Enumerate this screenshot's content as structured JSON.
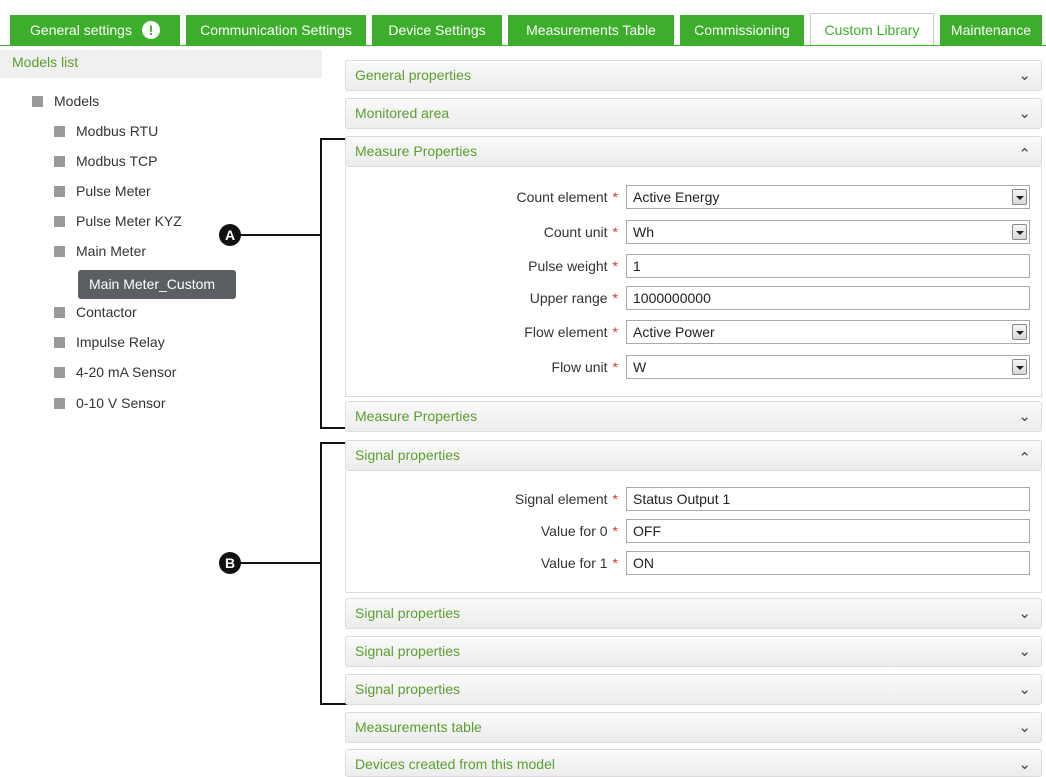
{
  "tabs": [
    {
      "label": "General settings",
      "warning": "!"
    },
    {
      "label": "Communication Settings"
    },
    {
      "label": "Device Settings"
    },
    {
      "label": "Measurements Table"
    },
    {
      "label": "Commissioning"
    },
    {
      "label": "Custom Library",
      "active": true
    },
    {
      "label": "Maintenance"
    }
  ],
  "models_list": {
    "header": "Models list",
    "root": "Models",
    "items": [
      "Modbus RTU",
      "Modbus TCP",
      "Pulse Meter",
      "Pulse Meter KYZ",
      "Main Meter"
    ],
    "selected_child": "Main Meter_Custom",
    "items_after": [
      "Contactor",
      "Impulse Relay",
      "4-20 mA Sensor",
      "0-10 V Sensor"
    ]
  },
  "callouts": {
    "a": "A",
    "b": "B"
  },
  "panels": {
    "general_properties": "General properties",
    "monitored_area": "Monitored area",
    "measure_properties_open": "Measure Properties",
    "measure_properties_closed": "Measure Properties",
    "signal_properties_open": "Signal properties",
    "signal_properties_closed_1": "Signal properties",
    "signal_properties_closed_2": "Signal properties",
    "signal_properties_closed_3": "Signal properties",
    "measurements_table": "Measurements table",
    "devices_created": "Devices created from this model"
  },
  "required_marker": "*",
  "measure_fields": [
    {
      "label": "Count element",
      "value": "Active Energy",
      "type": "select"
    },
    {
      "label": "Count unit",
      "value": "Wh",
      "type": "select"
    },
    {
      "label": "Pulse weight",
      "value": "1",
      "type": "text"
    },
    {
      "label": "Upper range",
      "value": "1000000000",
      "type": "text"
    },
    {
      "label": "Flow element",
      "value": "Active Power",
      "type": "select"
    },
    {
      "label": "Flow unit",
      "value": "W",
      "type": "select"
    }
  ],
  "signal_fields": [
    {
      "label": "Signal element",
      "value": "Status Output 1",
      "type": "text"
    },
    {
      "label": "Value for 0",
      "value": "OFF",
      "type": "text"
    },
    {
      "label": "Value for 1",
      "value": "ON",
      "type": "text"
    }
  ],
  "colors": {
    "accent": "#3dae2b",
    "header_text": "#5a9e2f",
    "required": "#e03030",
    "selected_node": "#5b5e63"
  },
  "icons": {
    "expand": "chevron-down-icon",
    "collapse": "chevron-up-icon",
    "tree_node": "minus-square-icon",
    "warning": "exclamation-circle-icon"
  }
}
